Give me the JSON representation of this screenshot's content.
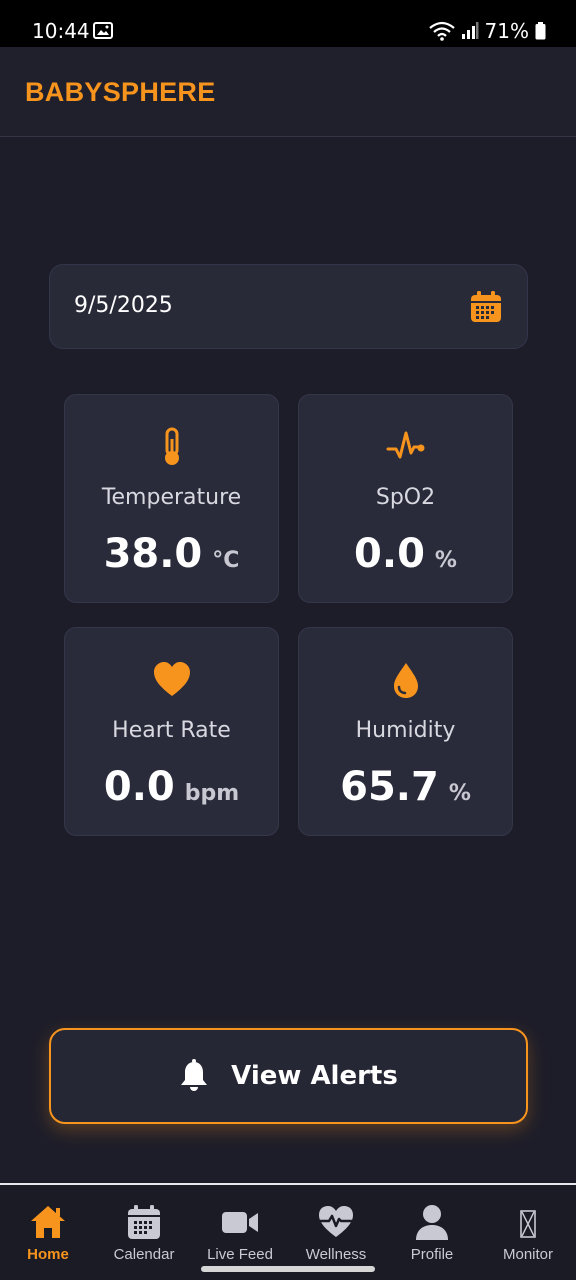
{
  "status_bar": {
    "time": "10:44",
    "battery": "71%",
    "icons": [
      "photo-icon",
      "wifi-icon",
      "signal-icon",
      "battery-icon"
    ]
  },
  "header": {
    "title": "BABYSPHERE"
  },
  "date_field": {
    "value": "9/5/2025",
    "icon": "calendar-icon"
  },
  "metrics": [
    {
      "label": "Temperature",
      "value": "38.0",
      "unit": "°C",
      "icon": "thermometer-icon"
    },
    {
      "label": "SpO2",
      "value": "0.0",
      "unit": "%",
      "icon": "pulse-icon"
    },
    {
      "label": "Heart Rate",
      "value": "0.0",
      "unit": "bpm",
      "icon": "heart-icon"
    },
    {
      "label": "Humidity",
      "value": "65.7",
      "unit": "%",
      "icon": "droplet-icon"
    }
  ],
  "alerts_button": {
    "label": "View Alerts",
    "icon": "bell-icon"
  },
  "nav": {
    "items": [
      {
        "label": "Home",
        "icon": "home-icon",
        "active": true
      },
      {
        "label": "Calendar",
        "icon": "calendar-icon",
        "active": false
      },
      {
        "label": "Live Feed",
        "icon": "video-icon",
        "active": false
      },
      {
        "label": "Wellness",
        "icon": "heartbeat-icon",
        "active": false
      },
      {
        "label": "Profile",
        "icon": "person-icon",
        "active": false
      },
      {
        "label": "Monitor",
        "icon": "hourglass-icon",
        "active": false
      }
    ]
  },
  "colors": {
    "accent": "#f7941d",
    "background": "#1d1d29",
    "card": "#2a2b3a"
  }
}
